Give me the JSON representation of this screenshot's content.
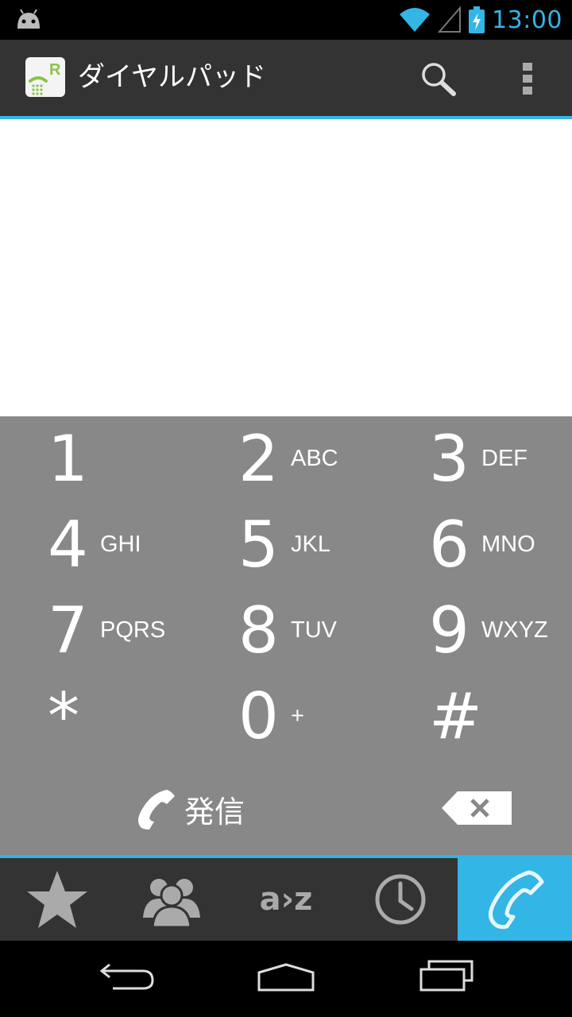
{
  "status_bar": {
    "time": "13:00",
    "icons": [
      "android-icon",
      "wifi-icon",
      "signal-icon",
      "battery-charging-icon"
    ],
    "time_color": "#33b5e5"
  },
  "action_bar": {
    "title": "ダイヤルパッド",
    "app_icon": "dialer-r-icon",
    "actions": [
      "search-icon",
      "overflow-menu-icon"
    ]
  },
  "number_display": {
    "value": ""
  },
  "keypad": {
    "keys": [
      {
        "digit": "1",
        "letters": ""
      },
      {
        "digit": "2",
        "letters": "ABC"
      },
      {
        "digit": "3",
        "letters": "DEF"
      },
      {
        "digit": "4",
        "letters": "GHI"
      },
      {
        "digit": "5",
        "letters": "JKL"
      },
      {
        "digit": "6",
        "letters": "MNO"
      },
      {
        "digit": "7",
        "letters": "PQRS"
      },
      {
        "digit": "8",
        "letters": "TUV"
      },
      {
        "digit": "9",
        "letters": "WXYZ"
      },
      {
        "digit": "*",
        "letters": ""
      },
      {
        "digit": "0",
        "letters": "+"
      },
      {
        "digit": "#",
        "letters": ""
      }
    ],
    "call_label": "発信",
    "background": "#888888"
  },
  "tab_bar": {
    "tabs": [
      {
        "icon": "star-icon",
        "name": "favorites"
      },
      {
        "icon": "contacts-icon",
        "name": "contacts"
      },
      {
        "icon": "a-to-z-icon",
        "name": "index",
        "text": "a›z"
      },
      {
        "icon": "clock-icon",
        "name": "history"
      },
      {
        "icon": "phone-icon",
        "name": "dialpad",
        "active": true
      }
    ],
    "accent": "#33b5e5"
  },
  "nav_bar": {
    "buttons": [
      "back-icon",
      "home-icon",
      "recents-icon"
    ]
  }
}
